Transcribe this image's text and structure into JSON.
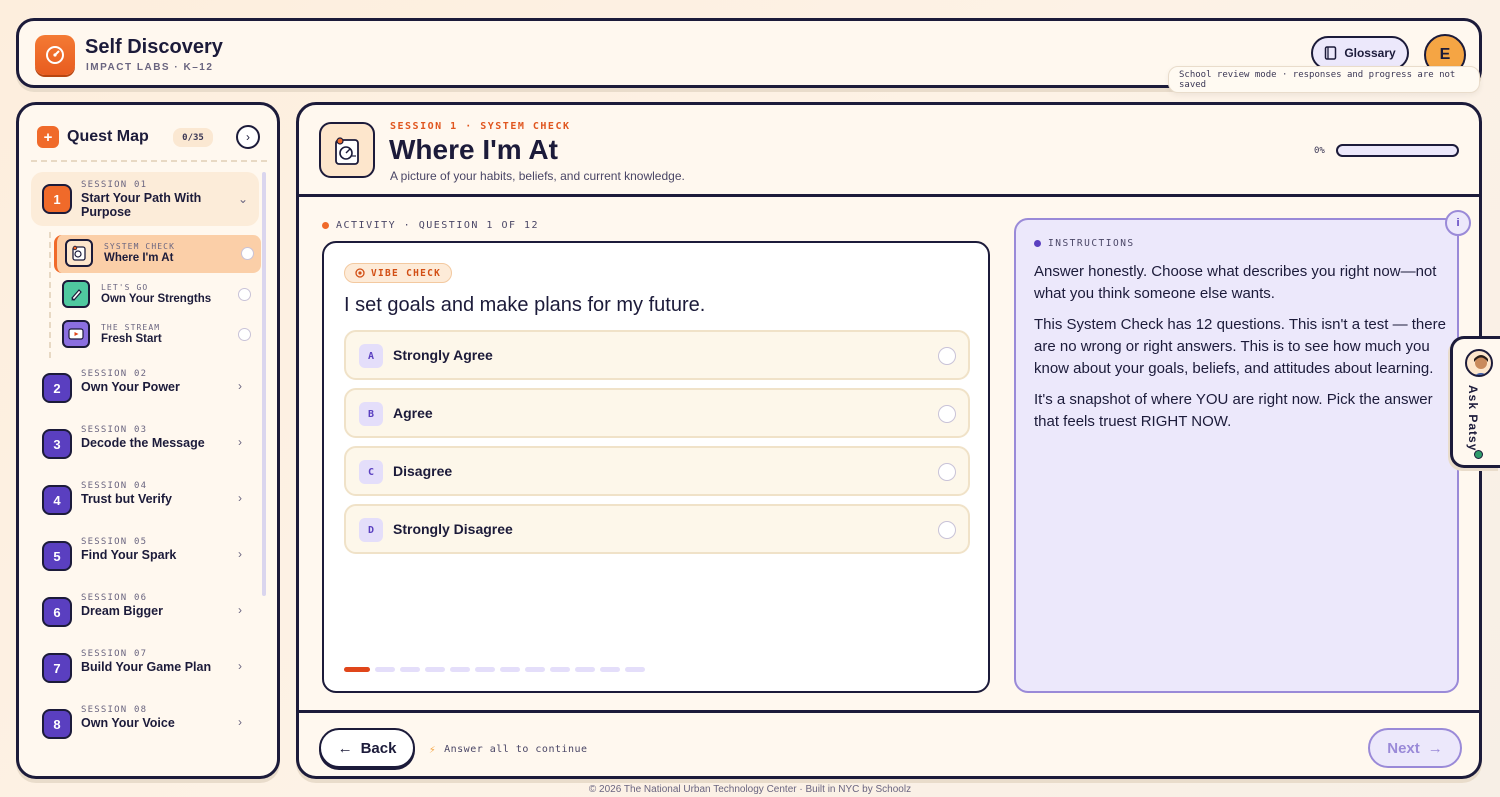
{
  "app": {
    "title": "Self Discovery",
    "subtitle": "IMPACT LABS · K–12",
    "glossary_label": "Glossary",
    "user_initial": "E",
    "review_note": "School review mode · responses and progress are not saved"
  },
  "sidebar": {
    "title": "Quest Map",
    "count": "0/35",
    "sessions": [
      {
        "num": "1",
        "label": "SESSION 01",
        "name": "Start Your Path With Purpose"
      },
      {
        "num": "2",
        "label": "SESSION 02",
        "name": "Own Your Power"
      },
      {
        "num": "3",
        "label": "SESSION 03",
        "name": "Decode the Message"
      },
      {
        "num": "4",
        "label": "SESSION 04",
        "name": "Trust but Verify"
      },
      {
        "num": "5",
        "label": "SESSION 05",
        "name": "Find Your Spark"
      },
      {
        "num": "6",
        "label": "SESSION 06",
        "name": "Dream Bigger"
      },
      {
        "num": "7",
        "label": "SESSION 07",
        "name": "Build Your Game Plan"
      },
      {
        "num": "8",
        "label": "SESSION 08",
        "name": "Own Your Voice"
      }
    ],
    "subitems": [
      {
        "label": "SYSTEM CHECK",
        "name": "Where I'm At",
        "icon": "clipboard-icon"
      },
      {
        "label": "LET'S GO",
        "name": "Own Your Strengths",
        "icon": "pencil-icon"
      },
      {
        "label": "THE STREAM",
        "name": "Fresh Start",
        "icon": "video-icon"
      }
    ]
  },
  "lesson": {
    "kicker": "SESSION 1 · SYSTEM CHECK",
    "title": "Where I'm At",
    "subtitle": "A picture of your habits, beliefs, and current knowledge.",
    "progress_label": "0%",
    "progress": 0
  },
  "activity": {
    "label": "ACTIVITY · QUESTION 1 OF 12",
    "badge": "VIBE CHECK",
    "question": "I set goals and make plans for my future.",
    "options": [
      {
        "letter": "A",
        "text": "Strongly Agree"
      },
      {
        "letter": "B",
        "text": "Agree"
      },
      {
        "letter": "C",
        "text": "Disagree"
      },
      {
        "letter": "D",
        "text": "Strongly Disagree"
      }
    ],
    "total_questions": 12,
    "current_question": 1
  },
  "instructions": {
    "label": "INSTRUCTIONS",
    "paragraphs": [
      "Answer honestly. Choose what describes you right now—not what you think someone else wants.",
      "This System Check has 12 questions. This isn't a test — there are no wrong or right answers. This is to see how much you know about your goals, beliefs, and attitudes about learning.",
      "It's a snapshot of where YOU are right now. Pick the answer that feels truest RIGHT NOW."
    ]
  },
  "footer_nav": {
    "back_label": "Back",
    "hint": "Answer all to continue",
    "next_label": "Next"
  },
  "patsy": {
    "label": "Ask Patsy"
  },
  "footer": {
    "text": "© 2026 The National Urban Technology Center · Built in NYC by Schoolz"
  },
  "colors": {
    "accent": "#f06a2a",
    "purple": "#5a3fc0",
    "ink": "#1c1b3a"
  }
}
